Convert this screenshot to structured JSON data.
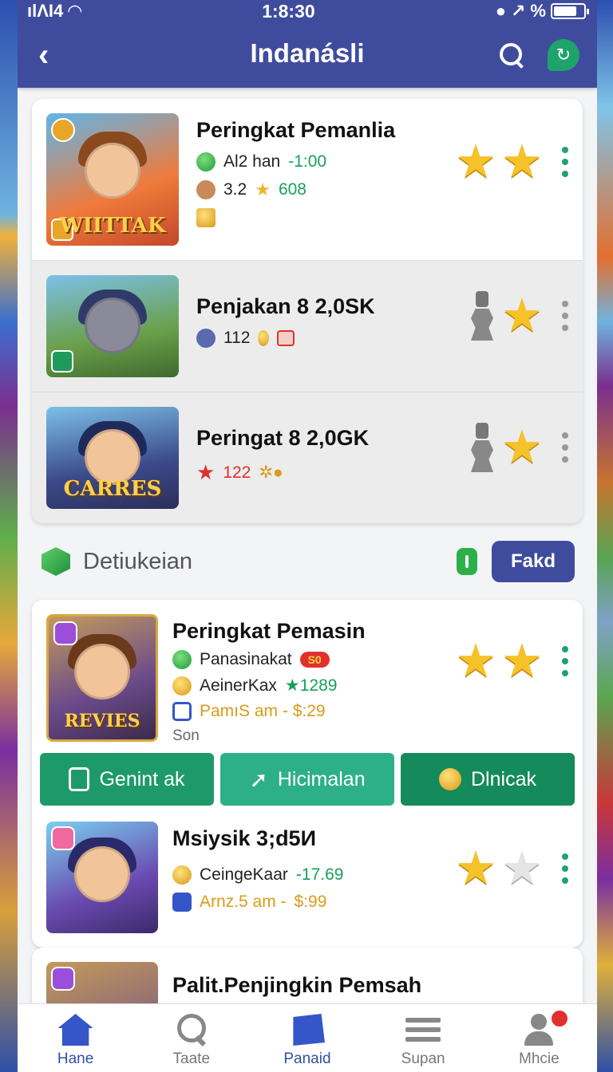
{
  "status_bar": {
    "signal_text": "ılΛΙ4",
    "time": "1:8:30",
    "battery_text": "%"
  },
  "header": {
    "title": "Indanásli"
  },
  "top_list": [
    {
      "thumb_text": "WIITTAK",
      "title": "Peringkat Pemanlia",
      "line1_label": "Al2 han",
      "line1_value": "-1:00",
      "line2_label": "3.2",
      "line2_value": "608"
    },
    {
      "thumb_text": "",
      "title": "Penjakan 8 2,0SK",
      "line1_label": "112"
    },
    {
      "thumb_text": "CARRES",
      "title": "Peringat 8 2,0GK",
      "line1_value": "122"
    }
  ],
  "section": {
    "title": "Detiukeian",
    "filter_label": "Fakd"
  },
  "featured": {
    "thumb_text": "REVIES",
    "title": "Peringkat Pemasin",
    "line1_label": "Panasinakat",
    "line1_tag": "S0",
    "line2_label": "AeinerKax",
    "line2_value": "1289",
    "line3_label": "PamıS am - $:29",
    "line4": "Son",
    "buttons": [
      "Genint ak",
      "Hicimalan",
      "Dlnicak"
    ]
  },
  "second": {
    "title": "Msiysik 3;d5И",
    "line1_label": "CeingeKaar",
    "line1_value": "-17.69",
    "line2_label": "Arnz.5 am -",
    "line2_value": "$:99"
  },
  "partial": {
    "title": "Palit.Penjingkin Pemsah"
  },
  "bottom_nav": [
    {
      "label": "Hane",
      "icon": "home-icon"
    },
    {
      "label": "Taate",
      "icon": "search-icon"
    },
    {
      "label": "Panaid",
      "icon": "panel-icon"
    },
    {
      "label": "Supan",
      "icon": "menu-icon"
    },
    {
      "label": "Mhcie",
      "icon": "user-icon"
    }
  ],
  "colors": {
    "primary": "#3f4c9e",
    "accent_green": "#1e9a6a",
    "star_gold": "#f5c22a",
    "alert_red": "#e1312c"
  }
}
